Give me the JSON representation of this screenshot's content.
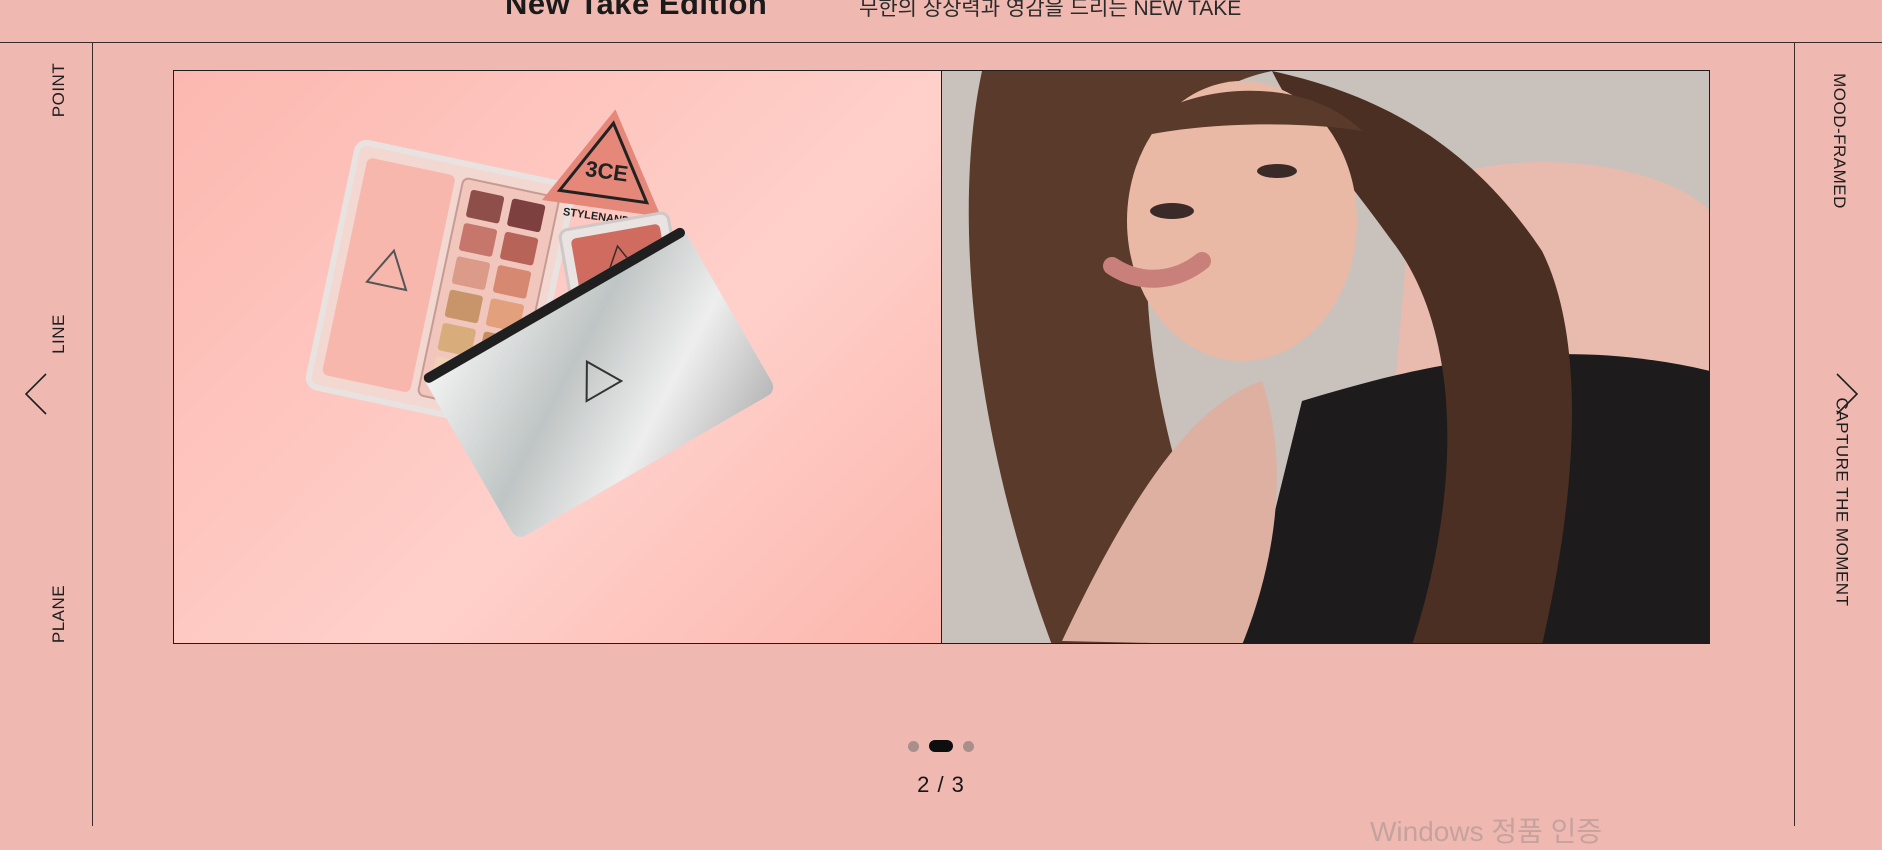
{
  "header": {
    "title": "New Take Edition",
    "subtitle": "무한의 상상력과 영감을 드리는 NEW TAKE"
  },
  "left_labels": [
    "POINT",
    "LINE",
    "PLANE"
  ],
  "right_labels": [
    "MOOD-FRAMED",
    "CAPTURE THE MOMENT"
  ],
  "slide": {
    "left_image_alt": "3CE Stylenanda eyeshadow palette, blush and silver pouch on pink background",
    "right_image_alt": "Model with long brown hair in black sheer top"
  },
  "product": {
    "brand_logo": "3CE",
    "brand_name": "STYLENANDA"
  },
  "pagination": {
    "dots": 3,
    "active_index": 1,
    "counter": "2 / 3"
  },
  "watermark": "Windows 정품 인증",
  "icons": {
    "prev": "chevron-left-icon",
    "next": "chevron-right-icon"
  },
  "colors": {
    "background": "#efb9b1",
    "active_dot": "#0e0e0e",
    "inactive_dot": "#a98f8b"
  }
}
